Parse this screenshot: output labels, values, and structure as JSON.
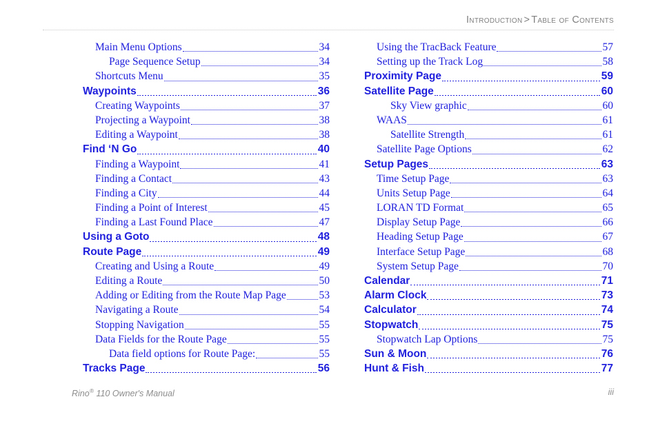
{
  "header": {
    "section": "Introduction",
    "separator": ">",
    "subsection": "Table of Contents"
  },
  "footer": {
    "manual_title_before": "Rino",
    "registered_mark": "®",
    "manual_title_after": " 110 Owner's Manual",
    "page_number": "iii"
  },
  "colors": {
    "entry_blue": "#2020dd",
    "header_gray": "#808080",
    "footer_gray": "#8d8d8d",
    "rule_gray": "#c9c9c9"
  },
  "toc": {
    "left_column": [
      {
        "level": 2,
        "title": "Main Menu Options",
        "page": "34"
      },
      {
        "level": 3,
        "title": "Page Sequence Setup",
        "page": "34"
      },
      {
        "level": 2,
        "title": "Shortcuts Menu",
        "page": "35"
      },
      {
        "level": 1,
        "title": "Waypoints",
        "page": "36"
      },
      {
        "level": 2,
        "title": "Creating Waypoints",
        "page": "37"
      },
      {
        "level": 2,
        "title": "Projecting a Waypoint",
        "page": "38"
      },
      {
        "level": 2,
        "title": "Editing a Waypoint",
        "page": "38"
      },
      {
        "level": 1,
        "title": "Find ‘N Go",
        "page": "40"
      },
      {
        "level": 2,
        "title": "Finding a Waypoint",
        "page": "41"
      },
      {
        "level": 2,
        "title": "Finding a Contact",
        "page": "43"
      },
      {
        "level": 2,
        "title": "Finding a City",
        "page": "44"
      },
      {
        "level": 2,
        "title": "Finding a Point of Interest",
        "page": "45"
      },
      {
        "level": 2,
        "title": "Finding a Last Found Place",
        "page": "47"
      },
      {
        "level": 1,
        "title": "Using a Goto",
        "page": "48"
      },
      {
        "level": 1,
        "title": "Route Page",
        "page": "49"
      },
      {
        "level": 2,
        "title": "Creating and Using a Route",
        "page": "49"
      },
      {
        "level": 2,
        "title": "Editing a Route",
        "page": "50"
      },
      {
        "level": 2,
        "title": "Adding or Editing from the Route Map Page",
        "page": "53"
      },
      {
        "level": 2,
        "title": "Navigating a Route",
        "page": "54"
      },
      {
        "level": 2,
        "title": "Stopping Navigation",
        "page": "55"
      },
      {
        "level": 2,
        "title": "Data Fields for the Route Page",
        "page": "55"
      },
      {
        "level": 3,
        "title": "Data field options for Route Page:",
        "page": "55"
      },
      {
        "level": 1,
        "title": "Tracks Page",
        "page": "56"
      }
    ],
    "right_column": [
      {
        "level": 2,
        "title": "Using the TracBack Feature",
        "page": "57"
      },
      {
        "level": 2,
        "title": "Setting up the Track Log",
        "page": "58"
      },
      {
        "level": 1,
        "title": "Proximity Page",
        "page": "59"
      },
      {
        "level": 1,
        "title": "Satellite Page",
        "page": "60"
      },
      {
        "level": 3,
        "title": "Sky View graphic",
        "page": "60"
      },
      {
        "level": 2,
        "title": "WAAS",
        "page": "61"
      },
      {
        "level": 3,
        "title": "Satellite Strength",
        "page": "61"
      },
      {
        "level": 2,
        "title": "Satellite Page Options",
        "page": "62"
      },
      {
        "level": 1,
        "title": "Setup Pages",
        "page": "63"
      },
      {
        "level": 2,
        "title": "Time Setup Page",
        "page": "63"
      },
      {
        "level": 2,
        "title": "Units Setup Page",
        "page": "64"
      },
      {
        "level": 2,
        "title": "LORAN TD Format",
        "page": "65"
      },
      {
        "level": 2,
        "title": "Display Setup Page",
        "page": "66"
      },
      {
        "level": 2,
        "title": "Heading Setup Page",
        "page": "67"
      },
      {
        "level": 2,
        "title": "Interface Setup Page",
        "page": "68"
      },
      {
        "level": 2,
        "title": "System Setup Page",
        "page": "70"
      },
      {
        "level": 1,
        "title": "Calendar",
        "page": "71"
      },
      {
        "level": 1,
        "title": "Alarm Clock",
        "page": "73"
      },
      {
        "level": 1,
        "title": "Calculator",
        "page": "74"
      },
      {
        "level": 1,
        "title": "Stopwatch",
        "page": "75"
      },
      {
        "level": 2,
        "title": "Stopwatch Lap Options",
        "page": "75"
      },
      {
        "level": 1,
        "title": "Sun & Moon",
        "page": "76"
      },
      {
        "level": 1,
        "title": "Hunt & Fish",
        "page": "77"
      }
    ]
  }
}
